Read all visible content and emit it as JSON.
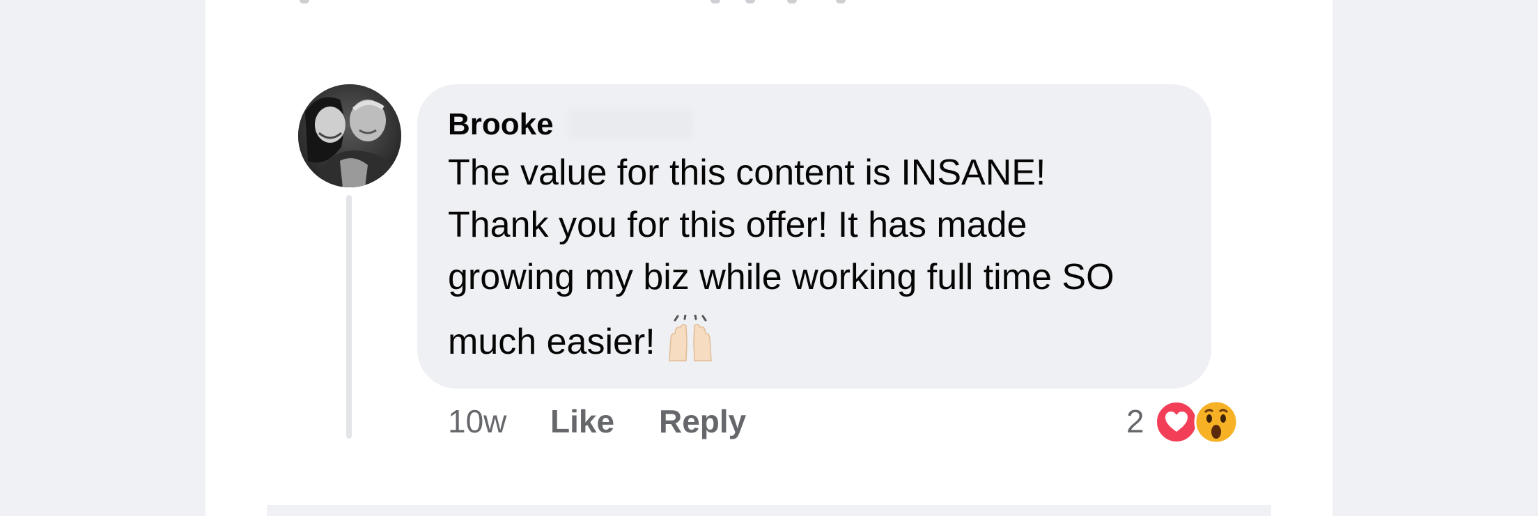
{
  "comment": {
    "author_first_name": "Brooke",
    "text_lines": [
      "The value for this content is INSANE!",
      "Thank you for this offer! It has made",
      "growing my biz while working full time SO",
      "much easier!"
    ],
    "time_ago": "10w",
    "like_label": "Like",
    "reply_label": "Reply",
    "reaction_count": "2",
    "reactions": [
      "heart-reaction-icon",
      "wow-reaction-icon"
    ],
    "emoji": "raising-hands-emoji"
  },
  "colors": {
    "bubble": "#eff0f4",
    "meta_text": "#65676b",
    "heart": "#f33e58",
    "wow": "#f7b125"
  }
}
